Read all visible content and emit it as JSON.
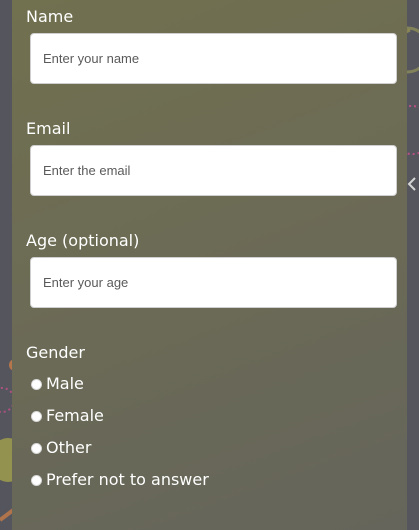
{
  "form": {
    "name": {
      "label": "Name",
      "placeholder": "Enter your name",
      "value": ""
    },
    "email": {
      "label": "Email",
      "placeholder": "Enter the email",
      "value": ""
    },
    "age": {
      "label": "Age (optional)",
      "placeholder": "Enter your age",
      "value": ""
    },
    "gender": {
      "label": "Gender",
      "options": [
        {
          "label": "Male",
          "selected": false
        },
        {
          "label": "Female",
          "selected": false
        },
        {
          "label": "Other",
          "selected": false
        },
        {
          "label": "Prefer not to answer",
          "selected": false
        }
      ]
    }
  },
  "colors": {
    "page_background": "#55555d",
    "panel_background": "#6c6b55",
    "text": "#ffffff",
    "input_background": "#ffffff",
    "placeholder_text": "#5a5a5a",
    "decoration_orange": "#c07a4a",
    "decoration_olive": "#9a9a4e",
    "decoration_pink": "#c64f8a"
  }
}
